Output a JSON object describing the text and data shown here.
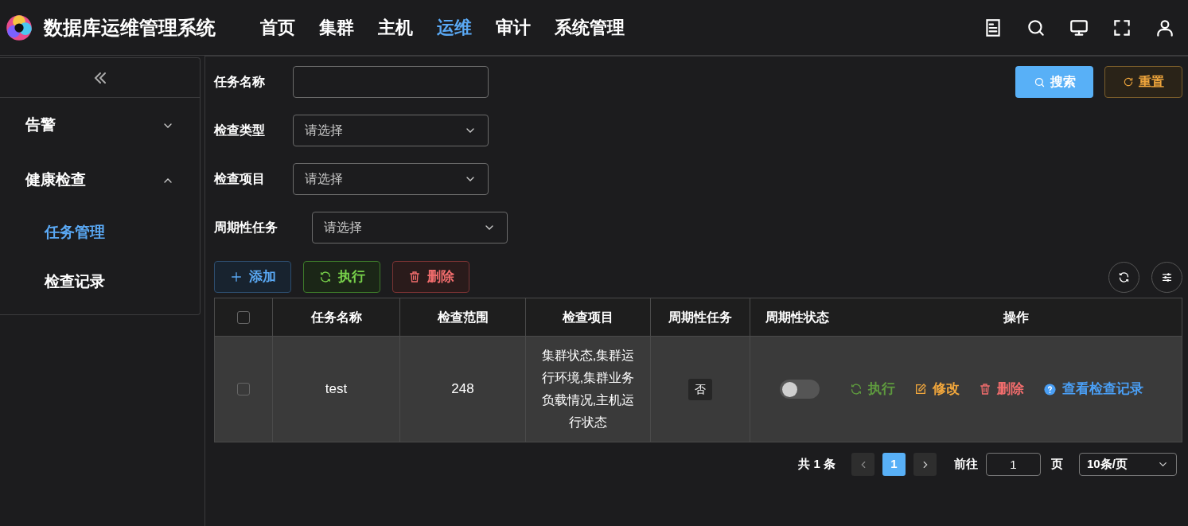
{
  "app": {
    "title": "数据库运维管理系统"
  },
  "nav": [
    {
      "label": "首页",
      "selected": false
    },
    {
      "label": "集群",
      "selected": false
    },
    {
      "label": "主机",
      "selected": false
    },
    {
      "label": "运维",
      "selected": true
    },
    {
      "label": "审计",
      "selected": false
    },
    {
      "label": "系统管理",
      "selected": false
    }
  ],
  "sidebar": {
    "groups": [
      {
        "label": "告警",
        "expanded": false
      },
      {
        "label": "健康检查",
        "expanded": true,
        "children": [
          {
            "label": "任务管理",
            "selected": true
          },
          {
            "label": "检查记录",
            "selected": false
          }
        ]
      }
    ]
  },
  "filters": [
    {
      "label": "任务名称",
      "kind": "text"
    },
    {
      "label": "检查类型",
      "kind": "select",
      "placeholder": "请选择"
    },
    {
      "label": "检查项目",
      "kind": "select",
      "placeholder": "请选择"
    },
    {
      "label": "周期性任务",
      "kind": "select",
      "placeholder": "请选择"
    }
  ],
  "search_button": "搜索",
  "reset_button": "重置",
  "toolbar": [
    {
      "label": "添加",
      "kind": "add"
    },
    {
      "label": "执行",
      "kind": "run"
    },
    {
      "label": "删除",
      "kind": "delete"
    }
  ],
  "table": {
    "all_checked": false,
    "columns": [
      "任务名称",
      "检查范围",
      "检查项目",
      "周期性任务",
      "周期性状态",
      "操作"
    ],
    "rows": [
      {
        "checked": false,
        "name": "test",
        "scope": "248",
        "items": "集群状态,集群运行环境,集群业务负载情况,主机运行状态",
        "periodic": "否",
        "periodic_on": false,
        "actions": [
          {
            "label": "执行",
            "kind": "run"
          },
          {
            "label": "修改",
            "kind": "edit"
          },
          {
            "label": "删除",
            "kind": "delete"
          },
          {
            "label": "查看检查记录",
            "kind": "view"
          }
        ]
      }
    ]
  },
  "pagination": {
    "total": "共 1 条",
    "pages": [
      {
        "label": "1",
        "selected": true
      }
    ],
    "goto_label": "前往",
    "goto_value": "1",
    "page_unit": "页",
    "page_size": "10条/页"
  }
}
